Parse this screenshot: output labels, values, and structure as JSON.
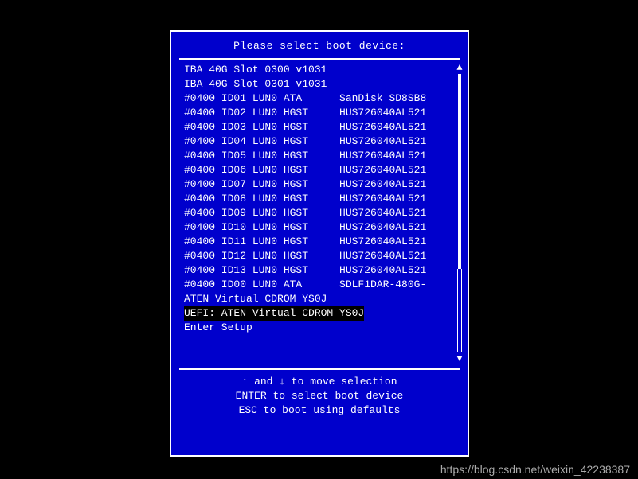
{
  "dialog": {
    "title": "Please select boot device:"
  },
  "boot_items": [
    {
      "label": "IBA 40G Slot 0300 v1031",
      "selected": false
    },
    {
      "label": "IBA 40G Slot 0301 v1031",
      "selected": false
    },
    {
      "label": "#0400 ID01 LUN0 ATA      SanDisk SD8SB8",
      "selected": false
    },
    {
      "label": "#0400 ID02 LUN0 HGST     HUS726040AL521",
      "selected": false
    },
    {
      "label": "#0400 ID03 LUN0 HGST     HUS726040AL521",
      "selected": false
    },
    {
      "label": "#0400 ID04 LUN0 HGST     HUS726040AL521",
      "selected": false
    },
    {
      "label": "#0400 ID05 LUN0 HGST     HUS726040AL521",
      "selected": false
    },
    {
      "label": "#0400 ID06 LUN0 HGST     HUS726040AL521",
      "selected": false
    },
    {
      "label": "#0400 ID07 LUN0 HGST     HUS726040AL521",
      "selected": false
    },
    {
      "label": "#0400 ID08 LUN0 HGST     HUS726040AL521",
      "selected": false
    },
    {
      "label": "#0400 ID09 LUN0 HGST     HUS726040AL521",
      "selected": false
    },
    {
      "label": "#0400 ID10 LUN0 HGST     HUS726040AL521",
      "selected": false
    },
    {
      "label": "#0400 ID11 LUN0 HGST     HUS726040AL521",
      "selected": false
    },
    {
      "label": "#0400 ID12 LUN0 HGST     HUS726040AL521",
      "selected": false
    },
    {
      "label": "#0400 ID13 LUN0 HGST     HUS726040AL521",
      "selected": false
    },
    {
      "label": "#0400 ID00 LUN0 ATA      SDLF1DAR-480G-",
      "selected": false
    },
    {
      "label": "ATEN Virtual CDROM YS0J",
      "selected": false
    },
    {
      "label": "UEFI: ATEN Virtual CDROM YS0J",
      "selected": true
    },
    {
      "label": "Enter Setup",
      "selected": false
    }
  ],
  "footer": {
    "hint_move": "↑ and ↓ to move selection",
    "hint_enter": "ENTER to select boot device",
    "hint_esc": "ESC to boot using defaults"
  },
  "watermark": "https://blog.csdn.net/weixin_42238387"
}
